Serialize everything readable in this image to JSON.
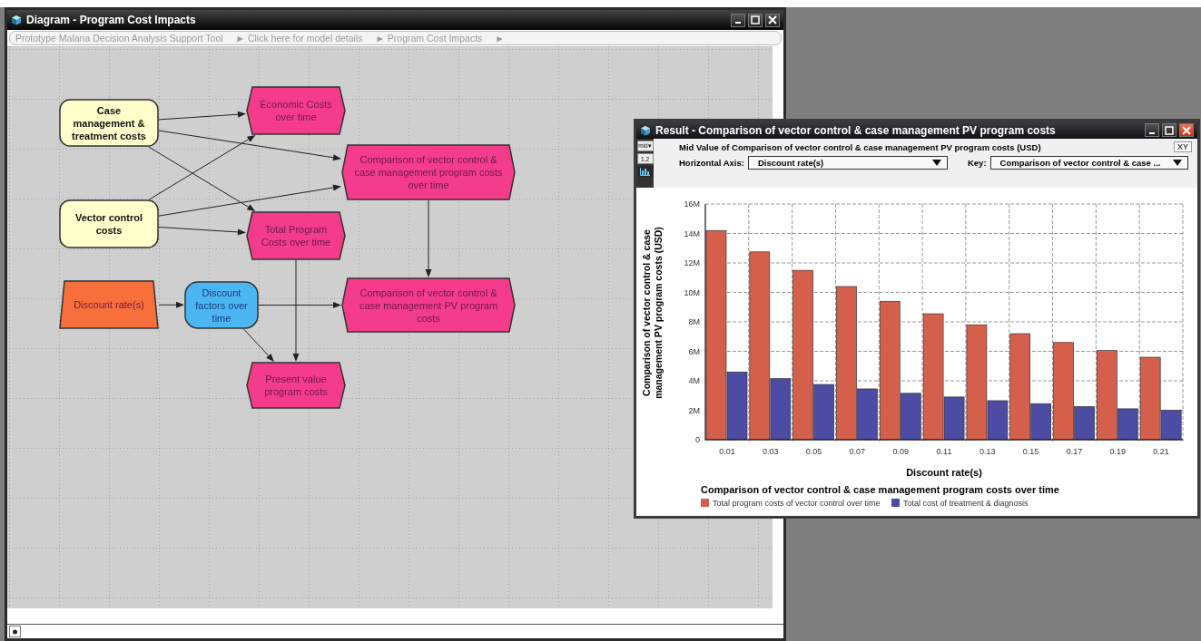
{
  "diagram_window": {
    "title": "Diagram - Program Cost Impacts",
    "breadcrumbs": [
      "Prototype Malaria Decision Analysis Support Tool",
      "► Click here for model details",
      "► Program Cost Impacts",
      "►"
    ],
    "nodes": [
      {
        "kind": "variable",
        "text": "Case management & treatment costs",
        "color": "#ffffcc"
      },
      {
        "kind": "variable",
        "text": "Vector control costs",
        "color": "#ffffcc"
      },
      {
        "kind": "input",
        "text": "Discount rate(s)",
        "color": "#f7703c"
      },
      {
        "kind": "chance",
        "text": "Discount factors over time",
        "color": "#4cb6f2"
      },
      {
        "kind": "objective",
        "text": "Economic Costs over time",
        "color": "#f53c8c"
      },
      {
        "kind": "objective",
        "text": "Comparison of vector control & case management program costs over time",
        "color": "#f53c8c"
      },
      {
        "kind": "objective",
        "text": "Total Program Costs over time",
        "color": "#f53c8c"
      },
      {
        "kind": "objective",
        "text": "Comparison of vector control & case management PV program costs",
        "color": "#f53c8c"
      },
      {
        "kind": "objective",
        "text": "Present value program costs",
        "color": "#f53c8c"
      }
    ]
  },
  "result_window": {
    "title": "Result - Comparison of vector control & case management PV program costs",
    "view_buttons": [
      {
        "kind": "mid",
        "label": "mid▾",
        "selected": false
      },
      {
        "kind": "table",
        "label": "1.2",
        "selected": false
      },
      {
        "kind": "graph",
        "selected": true
      }
    ],
    "heading": "Mid Value of Comparison of vector control & case management PV program costs (USD)",
    "xy_button": "XY",
    "horizontal_axis": {
      "label": "Horizontal Axis:",
      "value": "Discount rate(s)"
    },
    "key": {
      "label": "Key:",
      "value": "Comparison of vector control & case ..."
    },
    "chart_data": {
      "type": "bar",
      "grid": true,
      "legend": {
        "title": "Comparison of vector control & case management program costs over time"
      },
      "xlabel": "Discount rate(s)",
      "ylabel": "Comparison of vector control & case management PV program costs (USD)",
      "categories": [
        "0.01",
        "0.03",
        "0.05",
        "0.07",
        "0.09",
        "0.11",
        "0.13",
        "0.15",
        "0.17",
        "0.19",
        "0.21"
      ],
      "series": [
        {
          "name": "Total program costs of vector control over time",
          "color": "#d4604c",
          "values": [
            14200000,
            12750000,
            11500000,
            10400000,
            9400000,
            8550000,
            7800000,
            7200000,
            6600000,
            6050000,
            5600000
          ]
        },
        {
          "name": "Total cost of treatment & diagnosis",
          "color": "#4c4ca4",
          "values": [
            4600000,
            4150000,
            3750000,
            3450000,
            3150000,
            2900000,
            2650000,
            2450000,
            2250000,
            2100000,
            2000000
          ]
        }
      ],
      "ylim": [
        0,
        16000000
      ],
      "yticks": [
        {
          "value": 0,
          "label": "0"
        },
        {
          "value": 2000000,
          "label": "2M"
        },
        {
          "value": 4000000,
          "label": "4M"
        },
        {
          "value": 6000000,
          "label": "6M"
        },
        {
          "value": 8000000,
          "label": "8M"
        },
        {
          "value": 10000000,
          "label": "10M"
        },
        {
          "value": 12000000,
          "label": "12M"
        },
        {
          "value": 14000000,
          "label": "14M"
        },
        {
          "value": 16000000,
          "label": "16M"
        }
      ]
    }
  }
}
